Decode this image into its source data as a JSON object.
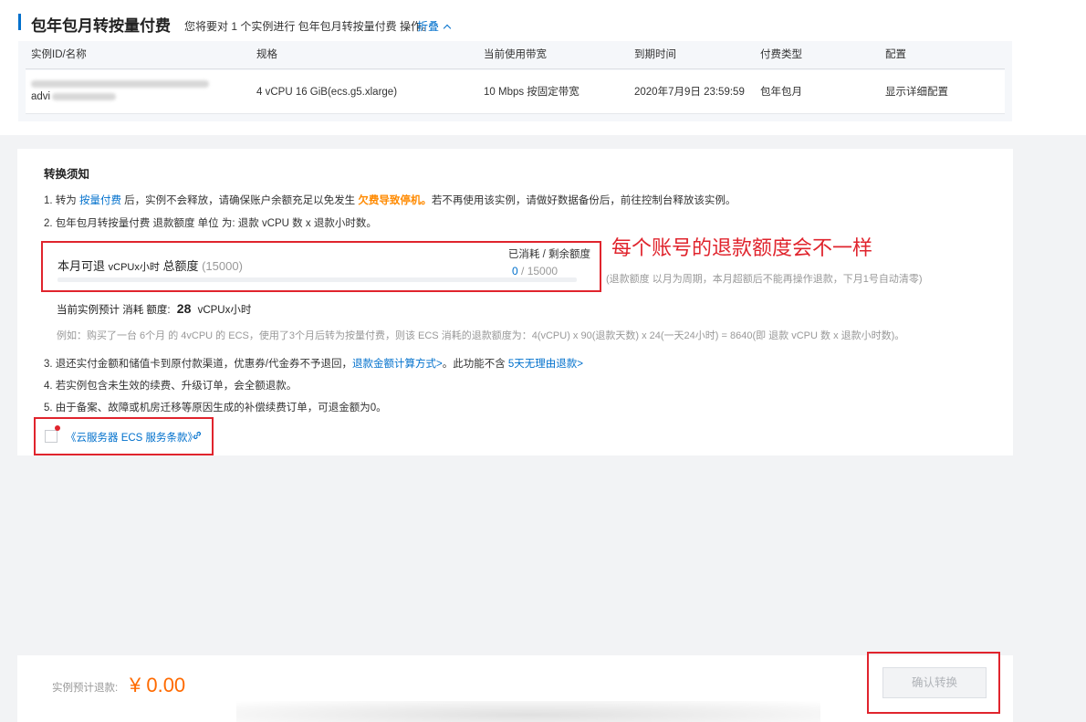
{
  "header": {
    "title": "包年包月转按量付费",
    "desc": "您将要对 1 个实例进行 包年包月转按量付费 操作。",
    "fold": "折叠"
  },
  "table": {
    "columns": [
      "实例ID/名称",
      "规格",
      "当前使用带宽",
      "到期时间",
      "付费类型",
      "配置"
    ],
    "row": {
      "name_prefix": "advi",
      "spec": "4 vCPU 16 GiB(ecs.g5.xlarge)",
      "bandwidth": "10 Mbps 按固定带宽",
      "expire": "2020年7月9日 23:59:59",
      "pay_type": "包年包月",
      "config_link": "显示详细配置"
    }
  },
  "notice": {
    "heading": "转换须知",
    "item1": {
      "pre": "1. 转为 ",
      "link": "按量付费",
      "mid": " 后，实例不会释放，请确保账户余额充足以免发生 ",
      "warn": "欠费导致停机。",
      "post": "若不再使用该实例，请做好数据备份后，前往控制台释放该实例。"
    },
    "item2": "2. 包年包月转按量付费 退款额度 单位 为: 退款 vCPU 数 x 退款小时数。",
    "quota": {
      "label_main": "本月可退 ",
      "label_unit": "vCPUx小时",
      "label_total": " 总额度 ",
      "label_total_val": "(15000)",
      "right_label": "已消耗 / 剩余额度",
      "used": "0",
      "sep": " / ",
      "remain": "15000",
      "used_fraction": 0
    },
    "quota_note": "(退款额度 以月为周期，本月超额后不能再操作退款，下月1号自动清零)",
    "annotation": "每个账号的退款额度会不一样",
    "estimate": {
      "pre": "当前实例预计 ",
      "consume": "消耗",
      "mid": " 额度: ",
      "value": "28",
      "unit": " vCPUx小时"
    },
    "example": "例如：购买了一台 6个月 的 4vCPU 的 ECS，使用了3个月后转为按量付费，则该 ECS 消耗的退款额度为：4(vCPU) x 90(退款天数) x 24(一天24小时) = 8640(即 退款 vCPU 数 x 退款小时数)。",
    "item3": {
      "pre": "3. 退还实付金额和储值卡到原付款渠道，优惠券/代金券不予退回，",
      "link1": "退款金额计算方式>",
      "mid": "。此功能不含 ",
      "link2": "5天无理由退款>"
    },
    "item4": "4. 若实例包含未生效的续费、升级订单，会全额退款。",
    "item5": "5. 由于备案、故障或机房迁移等原因生成的补偿续费订单，可退金额为0。",
    "terms_link": "《云服务器 ECS 服务条款》"
  },
  "footer": {
    "label": "实例预计退款:",
    "amount": "¥ 0.00",
    "confirm": "确认转换"
  },
  "colors": {
    "accent": "#0070cc",
    "warning": "#ff8a00",
    "annotation_red": "#e0242d",
    "amount_orange": "#ff6a00"
  }
}
